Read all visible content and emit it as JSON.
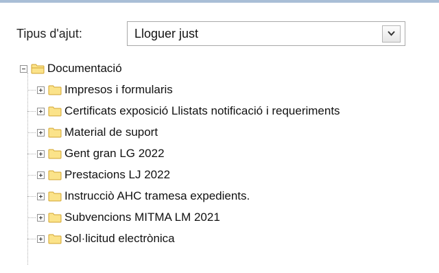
{
  "filter": {
    "label": "Tipus d'ajut:",
    "selected": "Lloguer just"
  },
  "tree": {
    "root": {
      "label": "Documentació",
      "expanded": true
    },
    "children": [
      {
        "label": "Impresos i formularis",
        "expanded": false
      },
      {
        "label": "Certificats exposició Llistats notificació i requeriments",
        "expanded": false
      },
      {
        "label": "Material de suport",
        "expanded": false
      },
      {
        "label": "Gent gran LG 2022",
        "expanded": false
      },
      {
        "label": "Prestacions LJ 2022",
        "expanded": false
      },
      {
        "label": "Instrucciò AHC tramesa expedients.",
        "expanded": false
      },
      {
        "label": "Subvencions MITMA LM 2021",
        "expanded": false
      },
      {
        "label": "Sol·licitud electrònica",
        "expanded": false
      }
    ]
  },
  "colors": {
    "folder_fill": "#fbe38a",
    "folder_stroke": "#d2a32e",
    "top_border": "#a9bed6"
  },
  "icons": {
    "expand": "plus-box-icon",
    "collapse": "minus-box-icon",
    "folder": "folder-icon",
    "dropdown": "chevron-down-icon"
  }
}
